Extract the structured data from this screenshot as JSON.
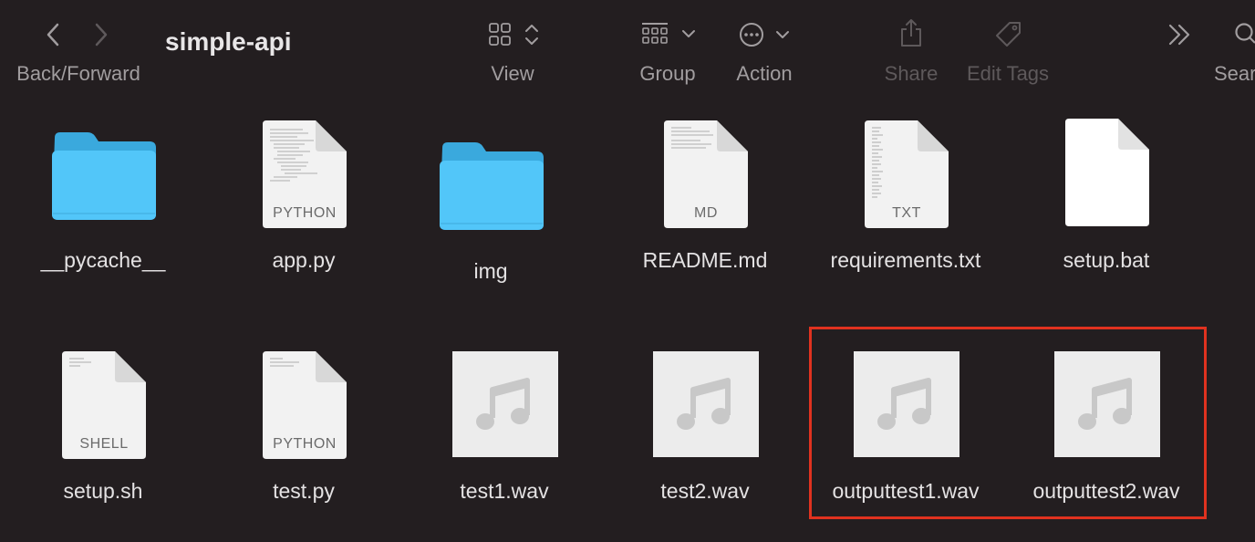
{
  "toolbar": {
    "back_forward_label": "Back/Forward",
    "title": "simple-api",
    "view_label": "View",
    "group_label": "Group",
    "action_label": "Action",
    "share_label": "Share",
    "edit_tags_label": "Edit Tags",
    "search_label": "Sear"
  },
  "files": [
    {
      "name": "__pycache__",
      "kind": "folder"
    },
    {
      "name": "app.py",
      "kind": "PYTHON"
    },
    {
      "name": "img",
      "kind": "folder"
    },
    {
      "name": "README.md",
      "kind": "MD"
    },
    {
      "name": "requirements.txt",
      "kind": "TXT"
    },
    {
      "name": "setup.bat",
      "kind": "blank"
    },
    {
      "name": "setup.sh",
      "kind": "SHELL"
    },
    {
      "name": "test.py",
      "kind": "PYTHON"
    },
    {
      "name": "test1.wav",
      "kind": "audio"
    },
    {
      "name": "test2.wav",
      "kind": "audio"
    },
    {
      "name": "outputtest1.wav",
      "kind": "audio"
    },
    {
      "name": "outputtest2.wav",
      "kind": "audio"
    }
  ],
  "colors": {
    "background": "#231e20",
    "folder": "#4fc3f7",
    "highlight": "#e0321f"
  }
}
